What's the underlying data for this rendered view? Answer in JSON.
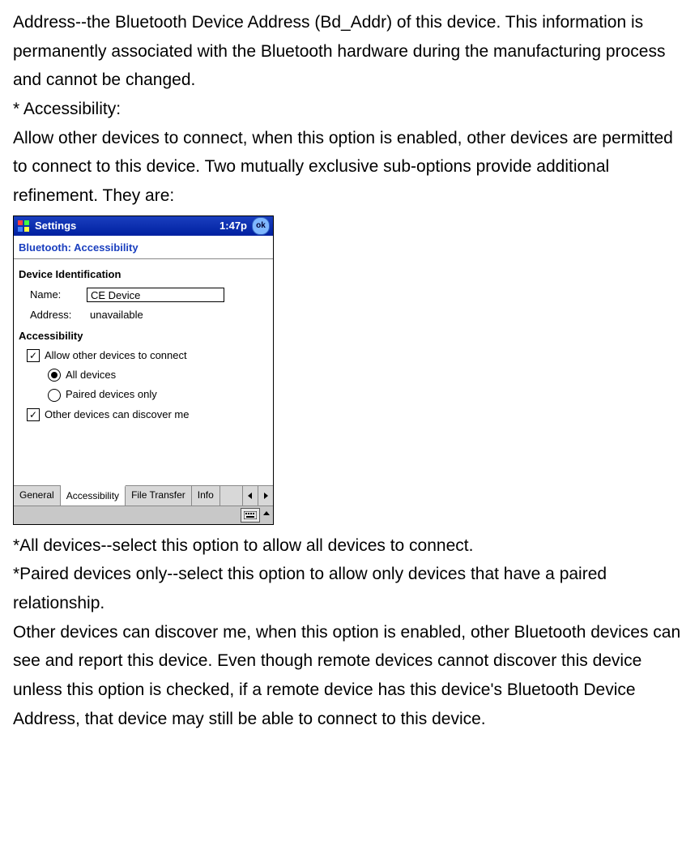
{
  "doc": {
    "p1": "Address--the Bluetooth Device Address (Bd_Addr) of this device. This information is permanently associated with the Bluetooth hardware during the manufacturing process and cannot be changed.",
    "p2": "* Accessibility:",
    "p3": "Allow other devices to connect, when this option is enabled, other devices are permitted to connect to this device. Two mutually exclusive sub-options provide additional refinement. They are:",
    "p4": "*All devices--select this option to allow all devices to connect.",
    "p5": "*Paired devices only--select this option to allow only devices that have a paired relationship.",
    "p6": "Other devices can discover me, when this option is enabled, other Bluetooth devices can see and report this device. Even though remote devices cannot discover this device unless this option is checked, if a remote device has this device's Bluetooth Device Address, that device may still be able to connect to this device."
  },
  "ppc": {
    "title": "Settings",
    "clock": "1:47p",
    "ok": "ok",
    "subtitle": "Bluetooth: Accessibility",
    "section_ident": "Device Identification",
    "name_label": "Name:",
    "name_value": "CE Device",
    "addr_label": "Address:",
    "addr_value": "unavailable",
    "section_access": "Accessibility",
    "opt_allow": "Allow other devices to connect",
    "opt_all": "All devices",
    "opt_paired": "Paired devices only",
    "opt_discover": "Other devices can discover me",
    "tabs": {
      "general": "General",
      "accessibility": "Accessibility",
      "filetransfer": "File Transfer",
      "info": "Info"
    }
  }
}
